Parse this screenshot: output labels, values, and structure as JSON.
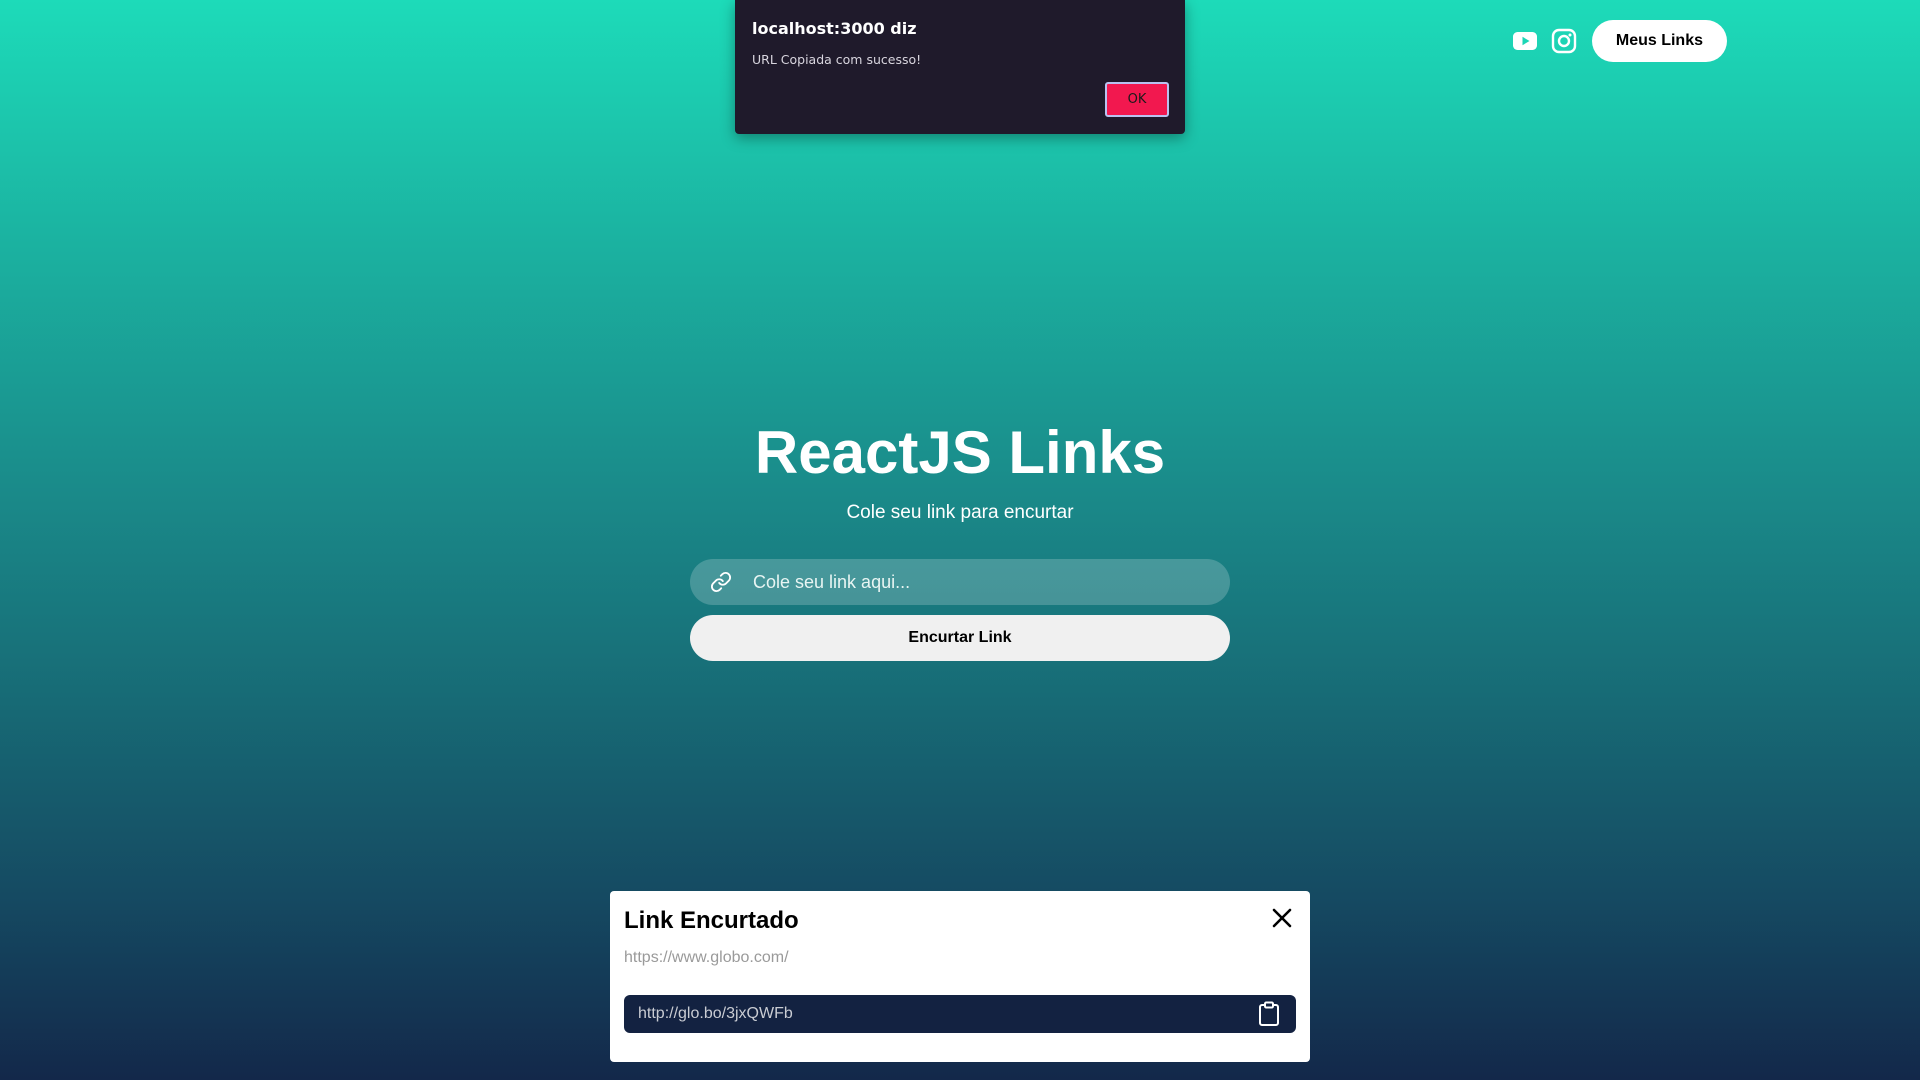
{
  "header": {
    "icons": [
      "youtube-icon",
      "instagram-icon"
    ],
    "my_links_label": "Meus Links"
  },
  "alert": {
    "title": "localhost:3000 diz",
    "message": "URL Copiada com sucesso!",
    "ok_label": "OK"
  },
  "hero": {
    "title": "ReactJS Links",
    "subtitle": "Cole seu link para encurtar"
  },
  "form": {
    "input_icon": "link-icon",
    "input_value": "",
    "input_placeholder": "Cole seu link aqui...",
    "submit_label": "Encurtar Link"
  },
  "result": {
    "title": "Link Encurtado",
    "original_url": "https://www.globo.com/",
    "short_url": "http://glo.bo/3jxQWFb",
    "copy_icon": "clipboard-icon",
    "close_icon": "close-icon"
  },
  "colors": {
    "gradient_top": "#1ddbb9",
    "gradient_bottom": "#13284a",
    "alert_bg": "#1f1a2b",
    "alert_ok_bg": "#f2184f",
    "short_link_bg": "#132241"
  }
}
